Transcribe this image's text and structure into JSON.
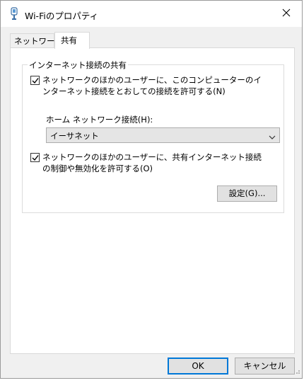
{
  "window": {
    "title": "Wi-Fiのプロパティ",
    "icon": "wifi-adapter-icon",
    "close_icon": "close-icon"
  },
  "tabs": [
    {
      "label": "ネットワーク",
      "selected": false
    },
    {
      "label": "共有",
      "selected": true
    }
  ],
  "sharing": {
    "group_title": "インターネット接続の共有",
    "allow_connect": {
      "label": "ネットワークのほかのユーザーに、このコンピューターのインターネット接続をとおしての接続を許可する(N)",
      "checked": true
    },
    "home_network_label": "ホーム ネットワーク接続(H):",
    "home_network_value": "イーサネット",
    "allow_control": {
      "label": "ネットワークのほかのユーザーに、共有インターネット接続の制御や無効化を許可する(O)",
      "checked": true
    },
    "settings_button": "設定(G)..."
  },
  "footer": {
    "ok": "OK",
    "cancel": "キャンセル"
  },
  "colors": {
    "accent": "#0078d7",
    "panel": "#ffffff",
    "frame": "#f0f0f0"
  }
}
